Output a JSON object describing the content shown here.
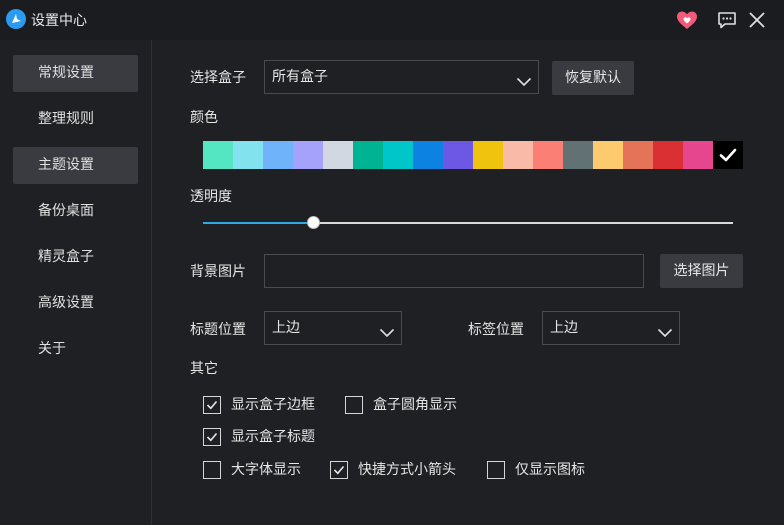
{
  "window": {
    "title": "设置中心"
  },
  "sidebar": {
    "items": [
      {
        "label": "常规设置",
        "active": true
      },
      {
        "label": "整理规则",
        "active": false
      },
      {
        "label": "主题设置",
        "active": true
      },
      {
        "label": "备份桌面",
        "active": false
      },
      {
        "label": "精灵盒子",
        "active": false
      },
      {
        "label": "高级设置",
        "active": false
      },
      {
        "label": "关于",
        "active": false
      }
    ]
  },
  "box_select": {
    "label": "选择盒子",
    "value": "所有盒子"
  },
  "restore_default_label": "恢复默认",
  "color": {
    "label": "颜色",
    "palette": [
      "#54e6c3",
      "#82e2ee",
      "#6fb3fb",
      "#a5a2fb",
      "#d2d8e2",
      "#00b493",
      "#00c5c9",
      "#0c83e2",
      "#6d58e6",
      "#f0c40e",
      "#f9bba8",
      "#fb7f75",
      "#627173",
      "#fdca6e",
      "#e57357",
      "#db3033",
      "#e5468e",
      "#000000"
    ],
    "selected_index": 17
  },
  "opacity": {
    "label": "透明度",
    "value_percent": 20.8
  },
  "background_image": {
    "label": "背景图片",
    "value": "",
    "choose_label": "选择图片"
  },
  "title_position": {
    "label": "标题位置",
    "value": "上边"
  },
  "tag_position": {
    "label": "标签位置",
    "value": "上边"
  },
  "other": {
    "label": "其它",
    "show_box_border": {
      "label": "显示盒子边框",
      "checked": true
    },
    "box_rounded": {
      "label": "盒子圆角显示",
      "checked": false
    },
    "show_box_title": {
      "label": "显示盒子标题",
      "checked": true
    },
    "large_font": {
      "label": "大字体显示",
      "checked": false
    },
    "shortcut_arrow": {
      "label": "快捷方式小箭头",
      "checked": true
    },
    "icon_only": {
      "label": "仅显示图标",
      "checked": false
    }
  },
  "icons": {
    "app": "desk-app-icon",
    "favorite": "heart-icon",
    "feedback": "chat-icon",
    "close": "close-icon",
    "dropdown": "chevron-down-icon",
    "check": "check-icon"
  },
  "theme": {
    "accent": "#2ea8e6",
    "heart": "#f25a7a",
    "background": "#1f2024"
  }
}
